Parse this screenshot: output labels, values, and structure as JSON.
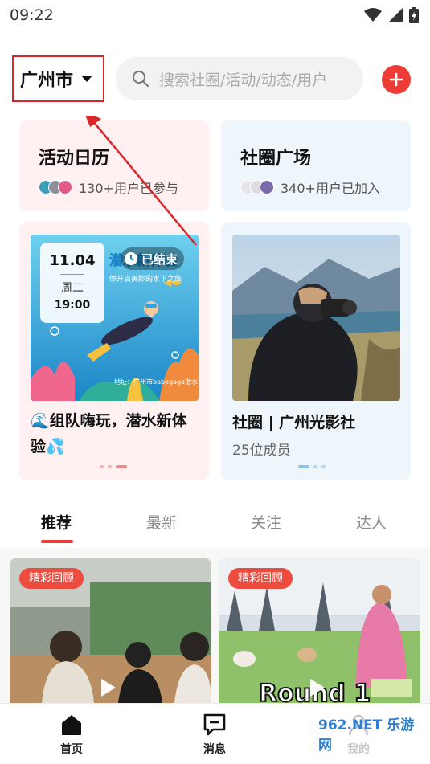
{
  "status_bar": {
    "time": "09:22"
  },
  "header": {
    "city": "广州市",
    "search_placeholder": "搜索社圈/活动/动态/用户"
  },
  "quick_cards": [
    {
      "title": "活动日历",
      "subtitle": "130+用户已参与"
    },
    {
      "title": "社圈广场",
      "subtitle": "340+用户已加入"
    }
  ],
  "promo_event": {
    "date": "11.04",
    "weekday": "周二",
    "time": "19:00",
    "status": "已结束",
    "poster_title": "潜水新体验",
    "poster_tagline": "你开启美妙的水下之旅",
    "poster_address": "地址：广州市babegaga潜水艺术空间",
    "title": "🌊组队嗨玩，潜水新体验💦"
  },
  "promo_circle": {
    "title": "社圈 | 广州光影社",
    "members": "25位成员"
  },
  "feed_tabs": [
    "推荐",
    "最新",
    "关注",
    "达人"
  ],
  "active_tab_index": 0,
  "feed_posts": [
    {
      "badge": "精彩回顾"
    },
    {
      "badge": "精彩回顾",
      "image_text": "Round 1"
    }
  ],
  "bottom_nav": [
    {
      "label": "首页",
      "icon": "home-icon"
    },
    {
      "label": "消息",
      "icon": "message-icon"
    },
    {
      "label": "我的",
      "icon": "profile-icon"
    }
  ],
  "watermark": "962.NET 乐游网",
  "colors": {
    "accent": "#ee3b36",
    "annotation": "#d8262a"
  }
}
